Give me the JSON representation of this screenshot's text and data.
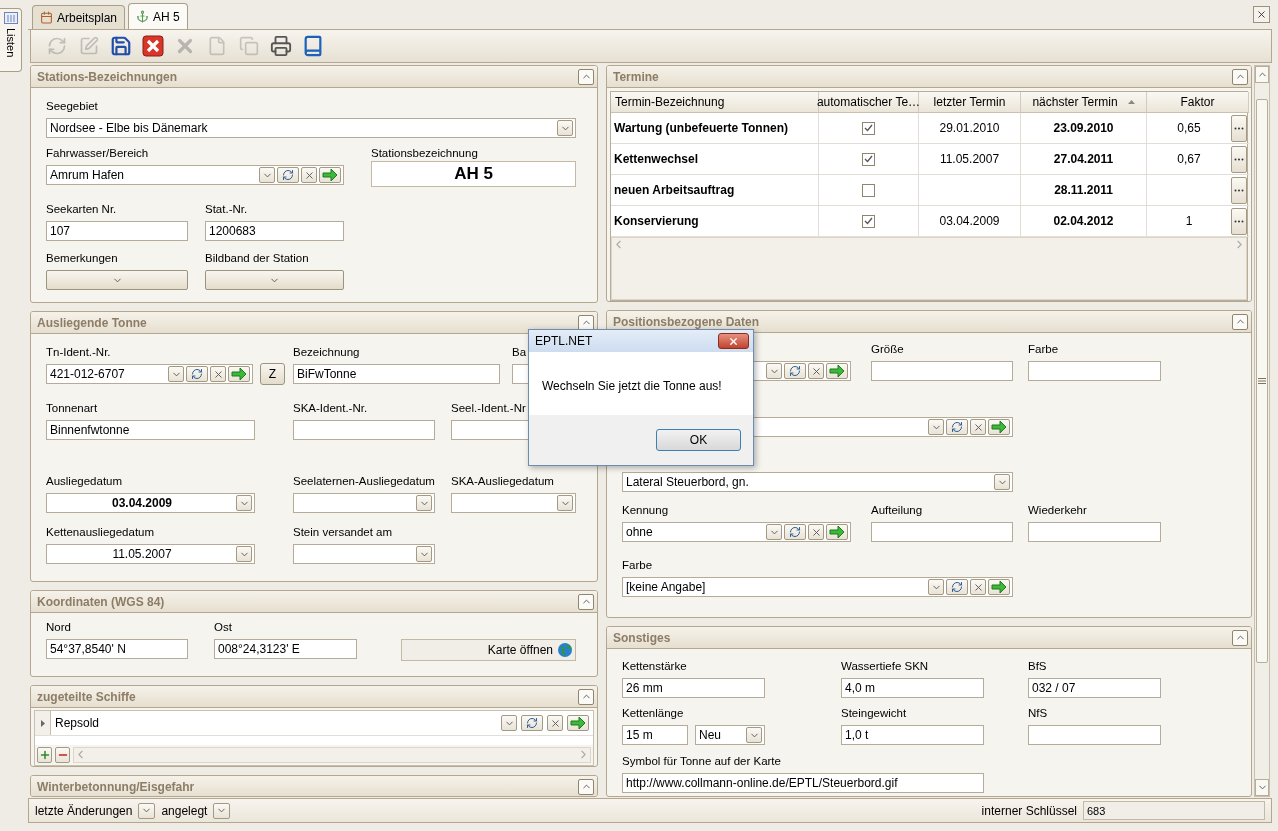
{
  "side_tab": {
    "label": "Listen"
  },
  "tabs": [
    {
      "label": "Arbeitsplan",
      "selected": false
    },
    {
      "label": "AH 5",
      "selected": true
    }
  ],
  "toolbar": [
    {
      "kind": "refresh",
      "disabled": true
    },
    {
      "kind": "edit",
      "disabled": true
    },
    {
      "kind": "save",
      "disabled": false
    },
    {
      "kind": "cancel",
      "disabled": false
    },
    {
      "kind": "delete",
      "disabled": true
    },
    {
      "kind": "new",
      "disabled": true
    },
    {
      "kind": "copy",
      "disabled": true
    },
    {
      "kind": "print",
      "disabled": false
    },
    {
      "kind": "book",
      "disabled": false
    }
  ],
  "left_panels": [
    {
      "kind": "form",
      "title": "Stations-Bezeichnungen",
      "rows": [
        [
          {
            "kind": "combo",
            "label": "Seegebiet",
            "value": "Nordsee - Elbe bis Dänemark"
          }
        ],
        [
          {
            "kind": "lookup",
            "label": "Fahrwasser/Bereich",
            "value": "Amrum Hafen"
          },
          {
            "kind": "title",
            "label": "Stationsbezeichnung",
            "value": "AH 5"
          }
        ],
        [
          {
            "kind": "text",
            "label": "Seekarten Nr.",
            "value": "107"
          },
          {
            "kind": "text",
            "label": "Stat.-Nr.",
            "value": "1200683"
          }
        ],
        [
          {
            "kind": "dropbutton",
            "label": "Bemerkungen"
          },
          {
            "kind": "dropbutton",
            "label": "Bildband der Station"
          }
        ]
      ]
    },
    {
      "kind": "form",
      "title": "Ausliegende Tonne",
      "rows": [
        [
          {
            "kind": "lookup",
            "label": "Tn-Ident.-Nr.",
            "value": "421-012-6707",
            "button": "Z"
          },
          {
            "kind": "text",
            "label": "Bezeichnung",
            "value": "BiFwTonne"
          },
          {
            "kind": "text",
            "label": "Ba"
          }
        ],
        [
          {
            "kind": "text",
            "label": "Tonnenart",
            "value": "Binnenfwtonne"
          },
          {
            "kind": "text",
            "label": "SKA-Ident.-Nr."
          },
          {
            "kind": "text",
            "label": "Seel.-Ident.-Nr"
          }
        ],
        [
          {
            "kind": "date",
            "label": "Ausliegedatum",
            "value": "03.04.2009",
            "bold": true
          },
          {
            "kind": "date",
            "label": "Seelaternen-Ausliegedatum"
          },
          {
            "kind": "date",
            "label": "SKA-Ausliegedatum"
          }
        ],
        [
          {
            "kind": "date",
            "label": "Kettenausliegedatum",
            "value": "11.05.2007",
            "bold": false
          },
          {
            "kind": "date",
            "label": "Stein versandet am"
          }
        ]
      ]
    },
    {
      "kind": "form",
      "title": "Koordinaten (WGS 84)",
      "rows": [
        [
          {
            "kind": "text",
            "label": "Nord",
            "value": "54°37,8540' N"
          },
          {
            "kind": "text",
            "label": "Ost",
            "value": "008°24,3123' E"
          },
          {
            "kind": "mapbutton",
            "text": "Karte öffnen"
          }
        ]
      ]
    },
    {
      "kind": "list",
      "title": "zugeteilte Schiffe",
      "items": [
        {
          "value": "Repsold"
        }
      ]
    },
    {
      "kind": "form",
      "title": "Winterbetonnung/Eisgefahr"
    }
  ],
  "right_panels": [
    {
      "kind": "table",
      "title": "Termine",
      "columns": [
        {
          "label": "Termin-Bezeichnung",
          "sorted": false
        },
        {
          "label": "automatischer Te…",
          "sorted": false
        },
        {
          "label": "letzter Termin",
          "sorted": false
        },
        {
          "label": "nächster Termin",
          "sorted": true
        },
        {
          "label": "Faktor",
          "sorted": false
        }
      ],
      "rows": [
        {
          "name": "Wartung (unbefeuerte Tonnen)",
          "auto": true,
          "last": "29.01.2010",
          "next": "23.09.2010",
          "factor": "0,65"
        },
        {
          "name": "Kettenwechsel",
          "auto": true,
          "last": "11.05.2007",
          "next": "27.04.2011",
          "factor": "0,67"
        },
        {
          "name": "neuen Arbeitsauftrag",
          "auto": false,
          "next": "28.11.2011"
        },
        {
          "name": "Konservierung",
          "auto": true,
          "last": "03.04.2009",
          "next": "02.04.2012",
          "factor": "1"
        }
      ]
    },
    {
      "kind": "form",
      "title": "Positionsbezogene Daten",
      "rows": [
        [
          {
            "kind": "lookup"
          },
          {
            "kind": "text",
            "label": "Größe"
          },
          {
            "kind": "text",
            "label": "Farbe"
          }
        ],
        [
          {
            "kind": "lookup"
          }
        ],
        [
          {
            "kind": "combo",
            "value": "Lateral Steuerbord, gn."
          }
        ],
        [
          {
            "kind": "lookup",
            "label": "Kennung",
            "value": "ohne"
          },
          {
            "kind": "text",
            "label": "Aufteilung"
          },
          {
            "kind": "text",
            "label": "Wiederkehr"
          }
        ],
        [
          {
            "kind": "lookup",
            "label": "Farbe",
            "value": "[keine Angabe]"
          }
        ]
      ]
    },
    {
      "kind": "form",
      "title": "Sonstiges",
      "rows": [
        [
          {
            "kind": "text",
            "label": "Kettenstärke",
            "value": "26 mm"
          },
          {
            "kind": "text",
            "label": "Wassertiefe SKN",
            "value": "4,0 m"
          },
          {
            "kind": "text",
            "label": "BfS",
            "value": "032 / 07"
          }
        ],
        [
          {
            "kind": "text",
            "label": "Kettenlänge",
            "value": "15 m",
            "option": "Neu"
          },
          {
            "kind": "text",
            "label": "Steingewicht",
            "value": "1,0 t"
          },
          {
            "kind": "text",
            "label": "NfS"
          }
        ],
        [
          {
            "kind": "text",
            "label": "Symbol für Tonne auf der Karte",
            "value": "http://www.collmann-online.de/EPTL/Steuerbord.gif"
          }
        ]
      ]
    }
  ],
  "status_bar": {
    "items": [
      {
        "label": "letzte Änderungen"
      },
      {
        "label": "angelegt"
      }
    ],
    "key_label": "interner Schlüssel",
    "key_value": "683"
  },
  "dialog": {
    "title": "EPTL.NET",
    "message": "Wechseln Sie jetzt die Tonne aus!",
    "button": "OK"
  }
}
